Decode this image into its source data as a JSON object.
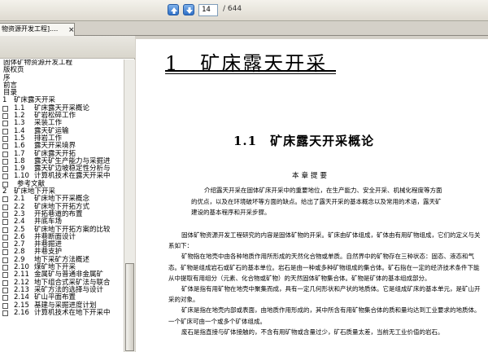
{
  "toolbar": {
    "page_current": "14",
    "page_total": "/ 644"
  },
  "tab": {
    "label": "物资源开发工程]....",
    "close": "×"
  },
  "bookmarks": [
    {
      "level": 0,
      "num": "",
      "title": "固体矿物资源开发工程"
    },
    {
      "level": 0,
      "num": "",
      "title": "版权页"
    },
    {
      "level": 0,
      "num": "",
      "title": "序"
    },
    {
      "level": 0,
      "num": "",
      "title": "前言"
    },
    {
      "level": 0,
      "num": "",
      "title": "目录"
    },
    {
      "level": 1,
      "num": "1",
      "title": "矿床露天开采"
    },
    {
      "level": 2,
      "num": "1.1",
      "title": "矿床露天开采概论"
    },
    {
      "level": 2,
      "num": "1.2",
      "title": "矿岩松碎工作"
    },
    {
      "level": 2,
      "num": "1.3",
      "title": "采装工作"
    },
    {
      "level": 2,
      "num": "1.4",
      "title": "露天矿运输"
    },
    {
      "level": 2,
      "num": "1.5",
      "title": "排岩工作"
    },
    {
      "level": 2,
      "num": "1.6",
      "title": "露天开采境界"
    },
    {
      "level": 2,
      "num": "1.7",
      "title": "矿床露天开拓"
    },
    {
      "level": 2,
      "num": "1.8",
      "title": "露天矿生产能力与采掘进"
    },
    {
      "level": 2,
      "num": "1.9",
      "title": "露天矿边坡稳定性分析与"
    },
    {
      "level": 2,
      "num": "1.10",
      "title": "计算机技术在露天开采中"
    },
    {
      "level": 3,
      "num": "",
      "title": "参考文献"
    },
    {
      "level": 1,
      "num": "2",
      "title": "矿床地下开采"
    },
    {
      "level": 2,
      "num": "2.1",
      "title": "矿床地下开采概念"
    },
    {
      "level": 2,
      "num": "2.2",
      "title": "矿床地下开拓方式"
    },
    {
      "level": 2,
      "num": "2.3",
      "title": "开拓巷道的布置"
    },
    {
      "level": 2,
      "num": "2.4",
      "title": "井底车场"
    },
    {
      "level": 2,
      "num": "2.5",
      "title": "矿床地下开拓方案的比较"
    },
    {
      "level": 2,
      "num": "2.6",
      "title": "井巷断面设计"
    },
    {
      "level": 2,
      "num": "2.7",
      "title": "井巷掘进"
    },
    {
      "level": 2,
      "num": "2.8",
      "title": "井巷支护"
    },
    {
      "level": 2,
      "num": "2.9",
      "title": "地下采矿方法概述"
    },
    {
      "level": 2,
      "num": "2.10",
      "title": "煤矿地下开采"
    },
    {
      "level": 2,
      "num": "2.11",
      "title": "金属矿与普通非金属矿"
    },
    {
      "level": 2,
      "num": "2.12",
      "title": "地下组合式采矿法与联合"
    },
    {
      "level": 2,
      "num": "2.13",
      "title": "采矿方法的选择与设计"
    },
    {
      "level": 2,
      "num": "2.14",
      "title": "矿山平面布置"
    },
    {
      "level": 2,
      "num": "2.15",
      "title": "基建与采掘进度计划"
    },
    {
      "level": 2,
      "num": "2.16",
      "title": "计算机技术在地下开采中"
    }
  ],
  "document": {
    "chapter_title": "1　矿床露天开采",
    "section_title": "1.1　矿床露天开采概论",
    "abstract_heading": "本章提要",
    "abstract_text": "介绍露天开采在固体矿床开采中的重要地位，在生产能力、安全开采、机械化程度等方面的优点，以及在环境破坏等方面的缺点。给出了露天开采的基本概念以及常用的术语，露天矿建设的基本程序和开采步骤。",
    "paragraphs": [
      "固体矿物资源开发工程研究的内容是固体矿物的开采。矿床由矿体组成，矿体由有用矿物组成，它们的定义与关系如下：",
      "矿物指在地壳中由各种地质作用所形成的天然化合物或单质。自然界中的矿物存在三种状态：固态、液态和气态。矿物是组成岩石或矿石的基本单位。岩石是由一种或多种矿物组成的集合体。矿石指在一定的经济技术条件下能从中提取有用组分（元素、化合物或矿物）的天然固体矿物集合体。矿物是矿体的基本组成部分。",
      "矿体是指有用矿物在地壳中聚集而成，具有一定几何形状和产状的地质体。它是组成矿床的基本单元，是矿山开采的对象。",
      "矿床是指在地壳内部或表面，由地质作用形成的，其中所含有用矿物集合体的质和量均达到工业要求的地质体。一个矿床可由一个或多个矿体组成。",
      "废石是指直接与矿体接触的，不含有用矿物或含量过少，矿石质量太差，当前无工业价值的岩石。"
    ]
  }
}
